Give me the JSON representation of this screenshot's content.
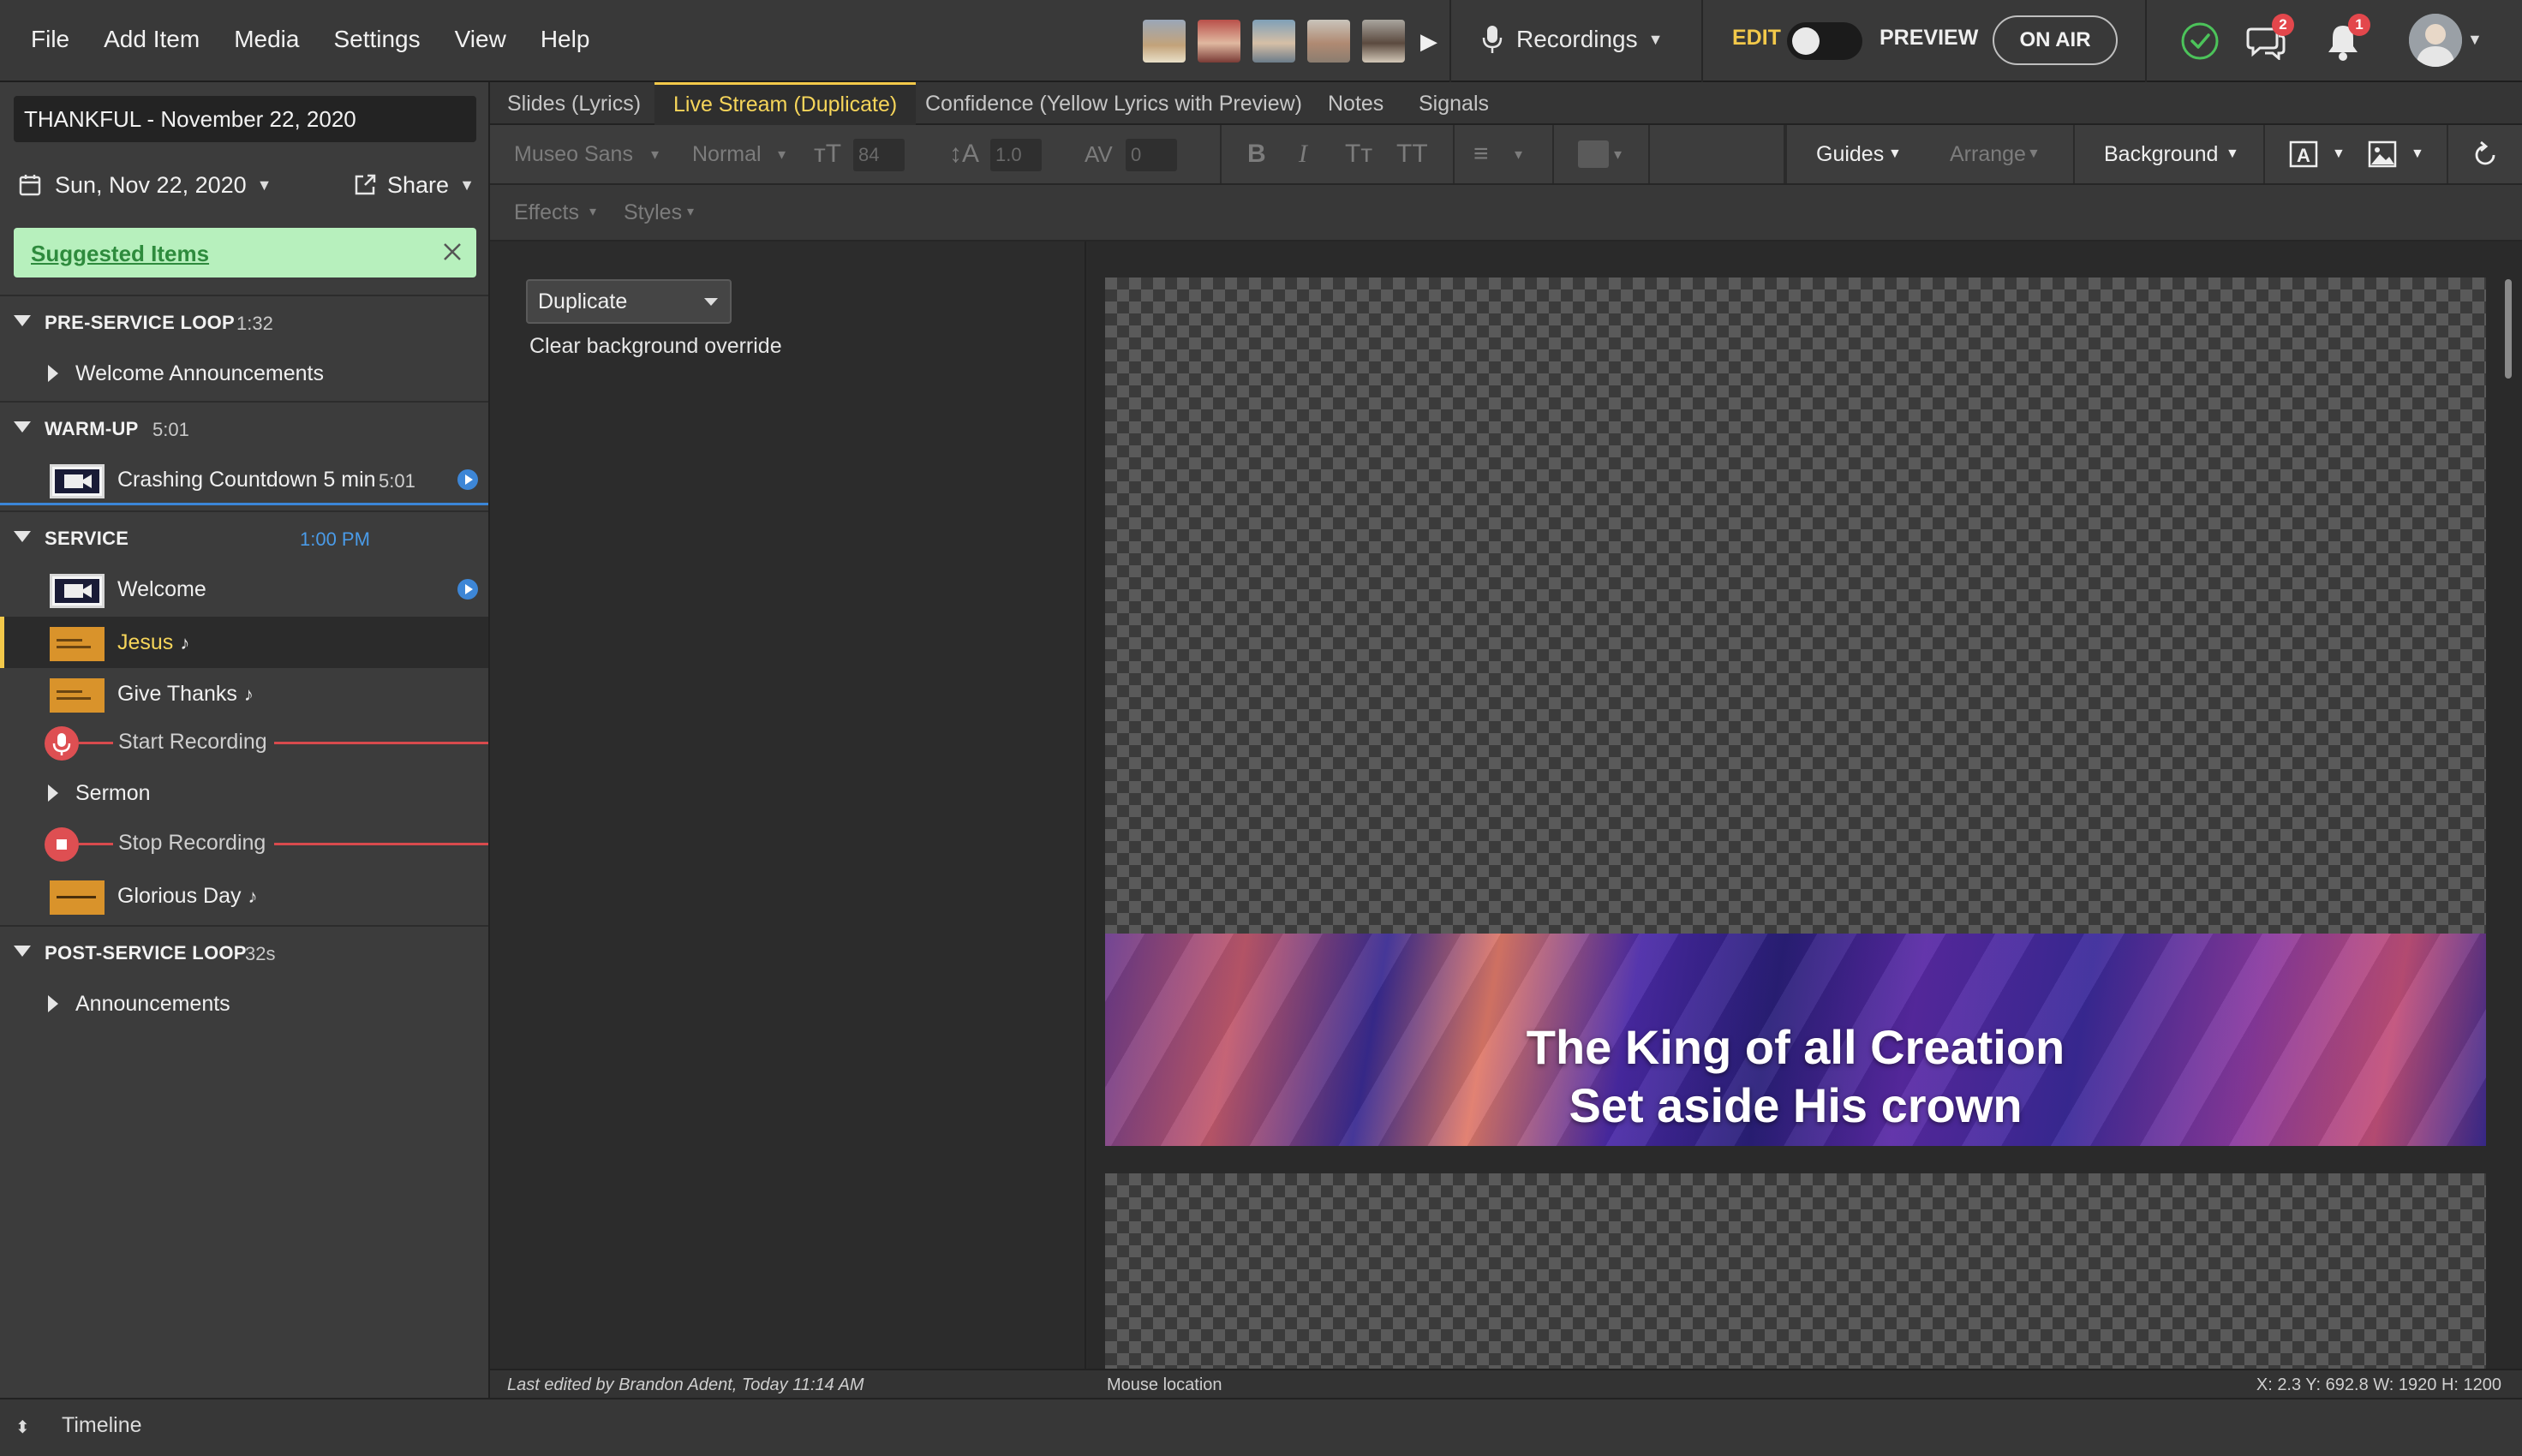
{
  "menu": [
    "File",
    "Add Item",
    "Media",
    "Settings",
    "View",
    "Help"
  ],
  "recordings": {
    "label": "Recordings"
  },
  "mode": {
    "edit": "EDIT",
    "preview": "PREVIEW",
    "on_air": "ON AIR"
  },
  "notifications": {
    "chat_count": "2",
    "bell_count": "1"
  },
  "sidebar": {
    "plan_title": "THANKFUL - November 22, 2020",
    "date": "Sun, Nov 22, 2020",
    "share": "Share",
    "suggested": "Suggested Items",
    "sections": [
      {
        "name": "PRE-SERVICE LOOP",
        "time": "1:32"
      },
      {
        "name": "WARM-UP",
        "time": "5:01"
      },
      {
        "name": "SERVICE",
        "time": "1:00 PM"
      },
      {
        "name": "POST-SERVICE LOOP",
        "time": "32s"
      }
    ],
    "items": {
      "welcome_announcements": "Welcome Announcements",
      "crashing_countdown": "Crashing Countdown 5 min",
      "crashing_countdown_dur": "5:01",
      "welcome": "Welcome",
      "jesus": "Jesus",
      "give_thanks": "Give Thanks",
      "start_recording": "Start Recording",
      "sermon": "Sermon",
      "stop_recording": "Stop Recording",
      "glorious_day": "Glorious Day",
      "announcements": "Announcements"
    },
    "note_symbol": "♪"
  },
  "tabs": [
    "Slides (Lyrics)",
    "Live Stream (Duplicate)",
    "Confidence (Yellow Lyrics with Preview)",
    "Notes",
    "Signals"
  ],
  "toolbar": {
    "font": "Museo Sans",
    "weight": "Normal",
    "size": "84",
    "line_height": "1.0",
    "spacing": "0",
    "guides": "Guides",
    "arrange": "Arrange",
    "background": "Background",
    "effects": "Effects",
    "styles": "Styles"
  },
  "panel": {
    "select_value": "Duplicate",
    "clear_bg": "Clear background override"
  },
  "slide": {
    "line1": "The King of all Creation",
    "line2": "Set aside His crown"
  },
  "status": {
    "last_edited": "Last edited by Brandon Adent, Today 11:14 AM",
    "mouse": "Mouse location",
    "coords": "X: 2.3  Y: 692.8    W: 1920  H: 1200"
  },
  "timeline": {
    "label": "Timeline"
  },
  "colors": {
    "accent_yellow": "#f3c94a",
    "play_blue": "#3d86d6",
    "record_red": "#de4f52",
    "suggested_green": "#b7f0bd"
  }
}
